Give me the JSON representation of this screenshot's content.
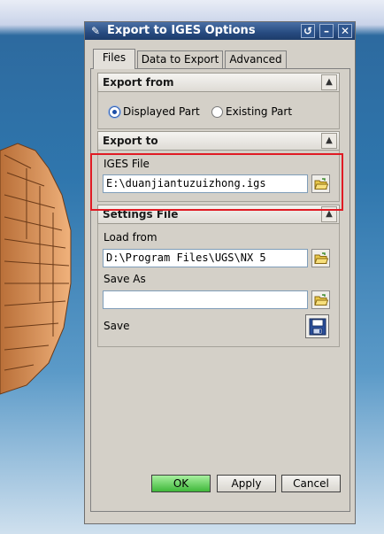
{
  "dialog": {
    "title": "Export to IGES Options",
    "tabs": [
      {
        "label": "Files",
        "active": true
      },
      {
        "label": "Data to Export",
        "active": false
      },
      {
        "label": "Advanced",
        "active": false
      }
    ]
  },
  "export_from": {
    "header": "Export from",
    "options": [
      {
        "label": "Displayed Part",
        "selected": true
      },
      {
        "label": "Existing Part",
        "selected": false
      }
    ]
  },
  "export_to": {
    "header": "Export to",
    "iges_file_label": "IGES File",
    "iges_file_value": "E:\\duanjiantuzuizhong.igs"
  },
  "settings_file": {
    "header": "Settings File",
    "load_from_label": "Load from",
    "load_from_value": "D:\\Program Files\\UGS\\NX 5",
    "save_as_label": "Save As",
    "save_as_value": "",
    "save_label": "Save"
  },
  "buttons": {
    "ok": "OK",
    "apply": "Apply",
    "cancel": "Cancel"
  },
  "colors": {
    "highlight": "#e01b24",
    "ok_button": "#3fb83a",
    "title_bar": "#274b80",
    "gear": "#d9935a"
  }
}
